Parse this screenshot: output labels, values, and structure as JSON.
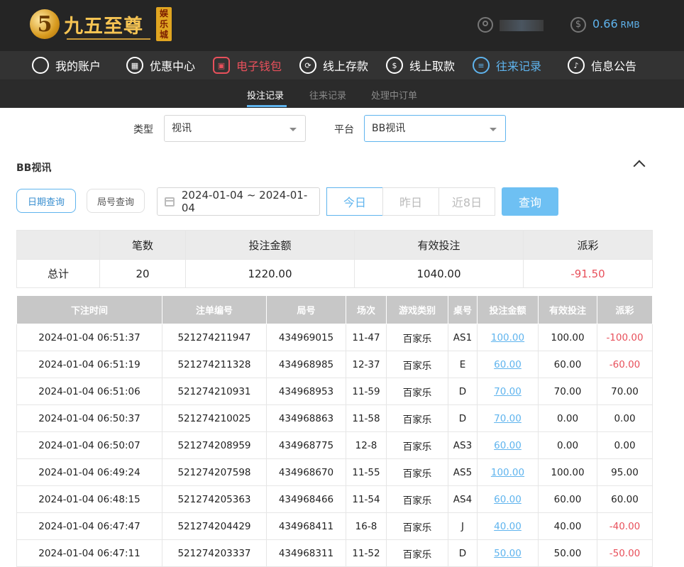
{
  "brand": {
    "logo_mark": "5",
    "title": "九五至尊",
    "subtitle": "娱乐城"
  },
  "account": {
    "balance": "0.66",
    "currency": "RMB",
    "icons": {
      "user": "user-icon",
      "coin": "coin-icon"
    }
  },
  "nav": {
    "items": [
      {
        "label": "我的账户",
        "icon": "user-circle-icon"
      },
      {
        "label": "优惠中心",
        "icon": "gift-icon"
      },
      {
        "label": "电子钱包",
        "icon": "wallet-icon",
        "color": "#e8505b"
      },
      {
        "label": "线上存款",
        "icon": "deposit-icon"
      },
      {
        "label": "线上取款",
        "icon": "withdraw-icon"
      },
      {
        "label": "往来记录",
        "icon": "records-icon",
        "color": "#5fb4ee"
      },
      {
        "label": "信息公告",
        "icon": "bell-icon"
      }
    ]
  },
  "subnav": {
    "items": [
      "投注记录",
      "往来记录",
      "处理中订单"
    ],
    "active": "投注记录"
  },
  "filters": {
    "type_label": "类型",
    "type_value": "视讯",
    "platform_label": "平台",
    "platform_value": "BB视讯"
  },
  "section": {
    "title": "BB视讯"
  },
  "query": {
    "mode_buttons": [
      "日期查询",
      "局号查询"
    ],
    "date_range": "2024-01-04 ~ 2024-01-04",
    "quick_ranges": [
      "今日",
      "昨日",
      "近8日"
    ],
    "submit_label": "查询"
  },
  "summary": {
    "headers": [
      "",
      "笔数",
      "投注金额",
      "有效投注",
      "派彩"
    ],
    "row": [
      "总计",
      "20",
      "1220.00",
      "1040.00",
      "-91.50"
    ]
  },
  "records": {
    "headers": [
      "下注时间",
      "注单编号",
      "局号",
      "场次",
      "游戏类别",
      "桌号",
      "投注金额",
      "有效投注",
      "派彩"
    ],
    "rows": [
      [
        "2024-01-04 06:51:37",
        "521274211947",
        "434969015",
        "11-47",
        "百家乐",
        "AS1",
        "100.00",
        "100.00",
        "-100.00"
      ],
      [
        "2024-01-04 06:51:19",
        "521274211328",
        "434968985",
        "12-37",
        "百家乐",
        "E",
        "60.00",
        "60.00",
        "-60.00"
      ],
      [
        "2024-01-04 06:51:06",
        "521274210931",
        "434968953",
        "11-59",
        "百家乐",
        "D",
        "70.00",
        "70.00",
        "70.00"
      ],
      [
        "2024-01-04 06:50:37",
        "521274210025",
        "434968863",
        "11-58",
        "百家乐",
        "D",
        "70.00",
        "0.00",
        "0.00"
      ],
      [
        "2024-01-04 06:50:07",
        "521274208959",
        "434968775",
        "12-8",
        "百家乐",
        "AS3",
        "60.00",
        "0.00",
        "0.00"
      ],
      [
        "2024-01-04 06:49:24",
        "521274207598",
        "434968670",
        "11-55",
        "百家乐",
        "AS5",
        "100.00",
        "100.00",
        "95.00"
      ],
      [
        "2024-01-04 06:48:15",
        "521274205363",
        "434968466",
        "11-54",
        "百家乐",
        "AS4",
        "60.00",
        "60.00",
        "60.00"
      ],
      [
        "2024-01-04 06:47:47",
        "521274204429",
        "434968411",
        "16-8",
        "百家乐",
        "J",
        "40.00",
        "40.00",
        "-40.00"
      ],
      [
        "2024-01-04 06:47:11",
        "521274203337",
        "434968311",
        "11-52",
        "百家乐",
        "D",
        "50.00",
        "50.00",
        "-50.00"
      ]
    ]
  }
}
